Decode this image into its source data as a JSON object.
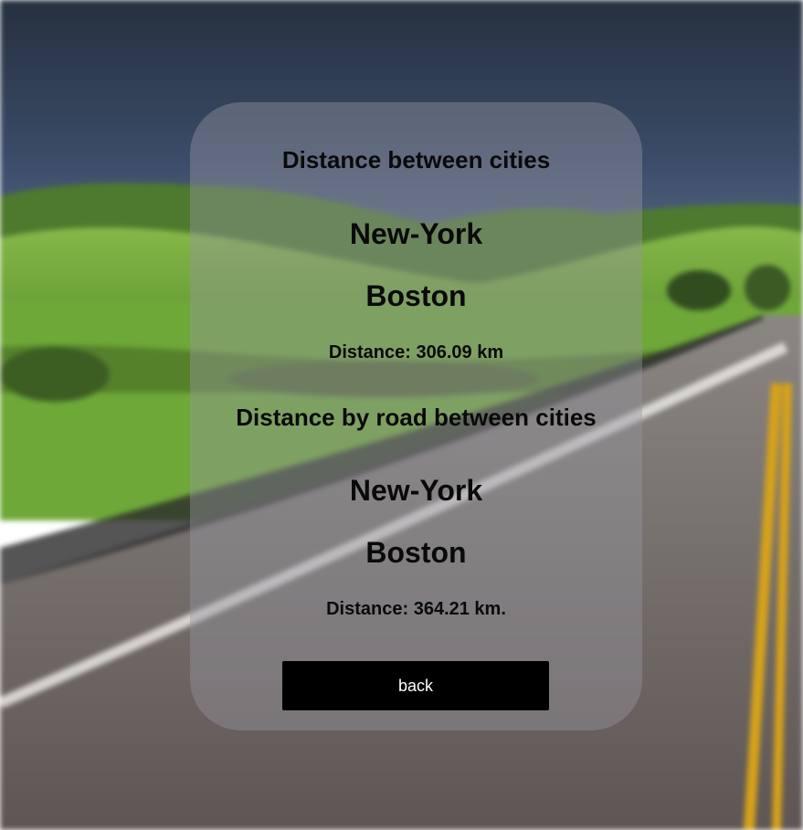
{
  "distance_section": {
    "title": "Distance between cities",
    "city_from": "New-York",
    "city_to": "Boston",
    "distance_text": "Distance: 306.09 km"
  },
  "road_section": {
    "title": "Distance by road between cities",
    "city_from": "New-York",
    "city_to": "Boston",
    "distance_text": "Distance: 364.21 km."
  },
  "back_button_label": "back",
  "colors": {
    "sky": "#2f3b4e",
    "hills": "#6aa336",
    "road": "#6d6766",
    "center_line": "#d6a21a",
    "button": "#000000"
  }
}
